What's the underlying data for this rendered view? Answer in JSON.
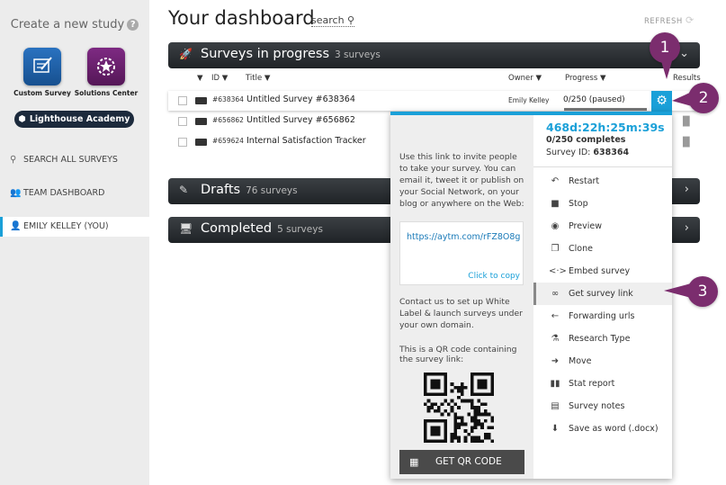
{
  "sidebar": {
    "create_title": "Create a new study",
    "tiles": [
      {
        "label": "Custom Survey",
        "color": "#1f5fa8",
        "icon": "pencil-doc-icon"
      },
      {
        "label": "Solutions Center",
        "color": "#6a1f6e",
        "icon": "gear-star-icon"
      }
    ],
    "academy_label": "Lighthouse Academy",
    "nav": [
      {
        "label": "SEARCH ALL SURVEYS",
        "icon": "search-icon"
      },
      {
        "label": "TEAM DASHBOARD",
        "icon": "team-icon"
      },
      {
        "label": "EMILY KELLEY (YOU)",
        "icon": "user-icon"
      }
    ]
  },
  "header": {
    "title": "Your dashboard",
    "search_label": "search",
    "refresh_label": "REFRESH"
  },
  "sections": {
    "in_progress": {
      "title": "Surveys in progress",
      "count": "3 surveys"
    },
    "drafts": {
      "title": "Drafts",
      "count": "76 surveys"
    },
    "completed": {
      "title": "Completed",
      "count": "5 surveys"
    }
  },
  "table": {
    "headers": {
      "id": "ID",
      "title": "Title",
      "owner": "Owner",
      "progress": "Progress",
      "results": "Results"
    },
    "rows": [
      {
        "id": "#638364",
        "title": "Untitled Survey #638364",
        "owner": "Emily Kelley",
        "progress": "0/250 (paused)"
      },
      {
        "id": "#656862",
        "title": "Untitled Survey #656862",
        "owner": "",
        "progress": ""
      },
      {
        "id": "#659624",
        "title": "Internal Satisfaction Tracker",
        "owner": "",
        "progress": ""
      }
    ]
  },
  "popup": {
    "invite_text": "Use this link to invite people to take your survey. You can email it, tweet it or publish on your Social Network, on your blog or anywhere on the Web:",
    "survey_url": "https://aytm.com/rFZ8O8g",
    "copy_label": "Click to copy",
    "white_label_text": "Contact us to set up White Label & launch surveys under your own domain.",
    "qr_text": "This is a QR code containing the survey link:",
    "qr_button": "GET QR CODE",
    "timer": "468d:22h:25m:39s",
    "completes": "0/250 completes",
    "survey_id_label": "Survey ID:",
    "survey_id": "638364",
    "menu": [
      {
        "label": "Restart",
        "icon": "restart-icon"
      },
      {
        "label": "Stop",
        "icon": "stop-icon"
      },
      {
        "label": "Preview",
        "icon": "eye-icon"
      },
      {
        "label": "Clone",
        "icon": "clone-icon"
      },
      {
        "label": "Embed survey",
        "icon": "code-icon"
      },
      {
        "label": "Get survey link",
        "icon": "link-icon",
        "active": true
      },
      {
        "label": "Forwarding urls",
        "icon": "arrow-left-icon"
      },
      {
        "label": "Research Type",
        "icon": "microscope-icon"
      },
      {
        "label": "Move",
        "icon": "arrow-right-icon"
      },
      {
        "label": "Stat report",
        "icon": "bar-chart-icon"
      },
      {
        "label": "Survey notes",
        "icon": "notes-icon"
      },
      {
        "label": "Save as word (.docx)",
        "icon": "download-icon"
      }
    ]
  },
  "callouts": [
    "1",
    "2",
    "3"
  ],
  "colors": {
    "accent": "#1aa0d8",
    "callout": "#7b2d6e",
    "band": "#2a2e31"
  }
}
